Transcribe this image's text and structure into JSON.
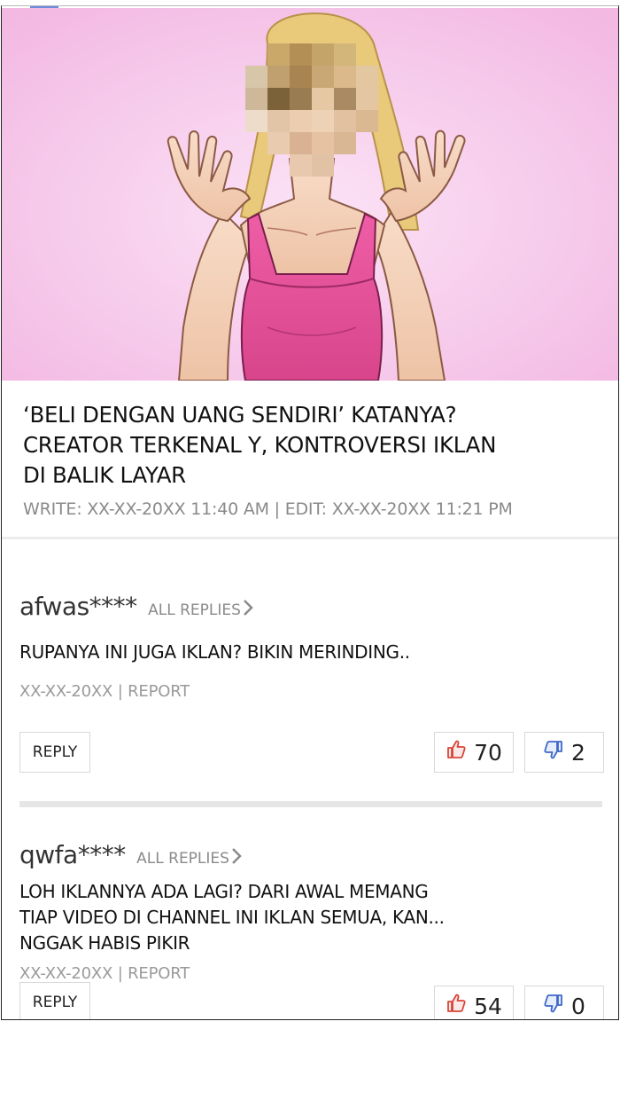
{
  "article": {
    "headline_lines": [
      "‘BELI DENGAN UANG SENDIRI’ KATANYA?",
      "CREATOR TERKENAL Y, KONTROVERSI IKLAN",
      "DI BALIK LAYAR"
    ],
    "meta": "WRITE: XX-XX-20XX 11:40 AM | EDIT: XX-XX-20XX 11:21 PM"
  },
  "comments": [
    {
      "username": "afwas****",
      "all_replies": "ALL REPLIES",
      "text_lines": [
        "RUPANYA INI JUGA IKLAN? BIKIN MERINDING.."
      ],
      "date_report": "XX-XX-20XX | REPORT",
      "reply": "REPLY",
      "likes": "70",
      "dislikes": "2"
    },
    {
      "username": "qwfa****",
      "all_replies": "ALL REPLIES",
      "text_lines": [
        "LOH IKLANNYA ADA LAGI? DARI AWAL MEMANG",
        "TIAP VIDEO DI CHANNEL INI IKLAN SEMUA, KAN...",
        "NGGAK HABIS PIKIR"
      ],
      "date_report": "XX-XX-20XX | REPORT",
      "reply": "REPLY",
      "likes": "54",
      "dislikes": "0"
    }
  ],
  "icons": {
    "like": "thumbs-up-icon",
    "dislike": "thumbs-down-icon",
    "all_replies": "chevron-right-icon"
  },
  "colors": {
    "hero_background": "#f8c9ec",
    "top_dress": "#e8539b",
    "like_red": "#d9453a",
    "dislike_blue": "#3f67c9",
    "muted_text": "#8a8a8a"
  }
}
